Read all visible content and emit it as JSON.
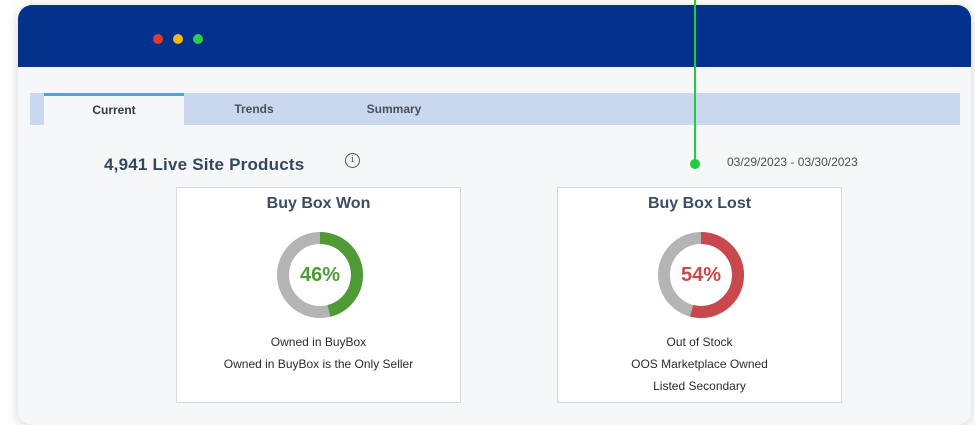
{
  "window": {
    "controls": [
      {
        "name": "close",
        "color": "#e23a2e"
      },
      {
        "name": "minimize",
        "color": "#f2b716"
      },
      {
        "name": "maximize",
        "color": "#2fcb4a"
      }
    ],
    "titlebar_color": "#03318c"
  },
  "tabs": [
    {
      "label": "Current",
      "active": true
    },
    {
      "label": "Trends",
      "active": false
    },
    {
      "label": "Summary",
      "active": false
    }
  ],
  "header": {
    "title": "4,941 Live Site Products",
    "info_icon": "i",
    "date_range": "03/29/2023 - 03/30/2023"
  },
  "cards": [
    {
      "title": "Buy Box Won",
      "percent_label": "46%",
      "percent_value": 46,
      "color": "#4e9a35",
      "lines": [
        "Owned in BuyBox",
        "Owned in BuyBox is the Only Seller"
      ]
    },
    {
      "title": "Buy Box Lost",
      "percent_label": "54%",
      "percent_value": 54,
      "color": "#c8484d",
      "lines": [
        "Out of Stock",
        "OOS Marketplace Owned",
        "Listed Secondary"
      ]
    }
  ],
  "colors": {
    "donut_track": "#b4b4b4",
    "tab_bar": "#c9d7ef",
    "tab_active_accent": "#45a7db",
    "pointer": "#1fcf3a"
  }
}
